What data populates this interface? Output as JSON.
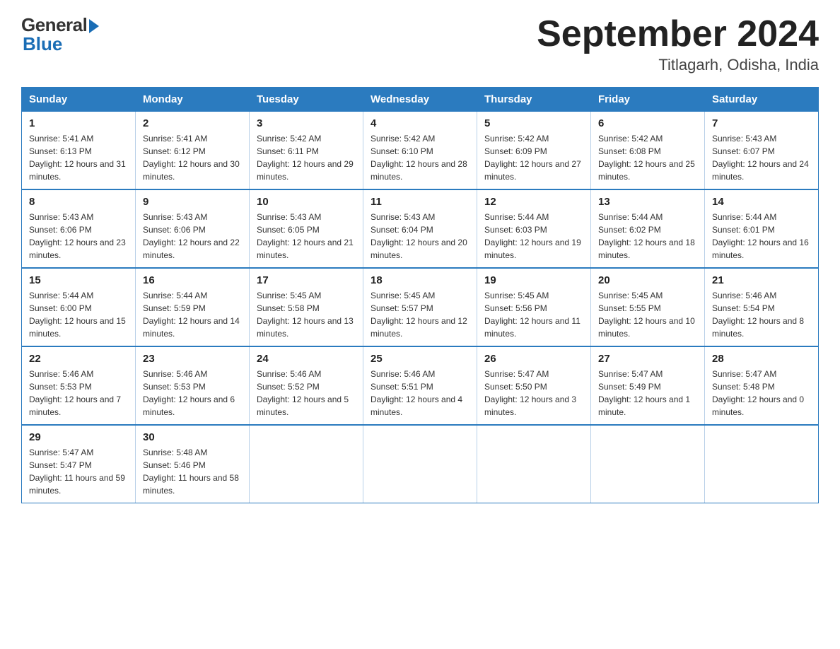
{
  "header": {
    "logo_general": "General",
    "logo_blue": "Blue",
    "month_title": "September 2024",
    "location": "Titlagarh, Odisha, India"
  },
  "days_of_week": [
    "Sunday",
    "Monday",
    "Tuesday",
    "Wednesday",
    "Thursday",
    "Friday",
    "Saturday"
  ],
  "weeks": [
    [
      {
        "day": "1",
        "sunrise": "5:41 AM",
        "sunset": "6:13 PM",
        "daylight": "12 hours and 31 minutes."
      },
      {
        "day": "2",
        "sunrise": "5:41 AM",
        "sunset": "6:12 PM",
        "daylight": "12 hours and 30 minutes."
      },
      {
        "day": "3",
        "sunrise": "5:42 AM",
        "sunset": "6:11 PM",
        "daylight": "12 hours and 29 minutes."
      },
      {
        "day": "4",
        "sunrise": "5:42 AM",
        "sunset": "6:10 PM",
        "daylight": "12 hours and 28 minutes."
      },
      {
        "day": "5",
        "sunrise": "5:42 AM",
        "sunset": "6:09 PM",
        "daylight": "12 hours and 27 minutes."
      },
      {
        "day": "6",
        "sunrise": "5:42 AM",
        "sunset": "6:08 PM",
        "daylight": "12 hours and 25 minutes."
      },
      {
        "day": "7",
        "sunrise": "5:43 AM",
        "sunset": "6:07 PM",
        "daylight": "12 hours and 24 minutes."
      }
    ],
    [
      {
        "day": "8",
        "sunrise": "5:43 AM",
        "sunset": "6:06 PM",
        "daylight": "12 hours and 23 minutes."
      },
      {
        "day": "9",
        "sunrise": "5:43 AM",
        "sunset": "6:06 PM",
        "daylight": "12 hours and 22 minutes."
      },
      {
        "day": "10",
        "sunrise": "5:43 AM",
        "sunset": "6:05 PM",
        "daylight": "12 hours and 21 minutes."
      },
      {
        "day": "11",
        "sunrise": "5:43 AM",
        "sunset": "6:04 PM",
        "daylight": "12 hours and 20 minutes."
      },
      {
        "day": "12",
        "sunrise": "5:44 AM",
        "sunset": "6:03 PM",
        "daylight": "12 hours and 19 minutes."
      },
      {
        "day": "13",
        "sunrise": "5:44 AM",
        "sunset": "6:02 PM",
        "daylight": "12 hours and 18 minutes."
      },
      {
        "day": "14",
        "sunrise": "5:44 AM",
        "sunset": "6:01 PM",
        "daylight": "12 hours and 16 minutes."
      }
    ],
    [
      {
        "day": "15",
        "sunrise": "5:44 AM",
        "sunset": "6:00 PM",
        "daylight": "12 hours and 15 minutes."
      },
      {
        "day": "16",
        "sunrise": "5:44 AM",
        "sunset": "5:59 PM",
        "daylight": "12 hours and 14 minutes."
      },
      {
        "day": "17",
        "sunrise": "5:45 AM",
        "sunset": "5:58 PM",
        "daylight": "12 hours and 13 minutes."
      },
      {
        "day": "18",
        "sunrise": "5:45 AM",
        "sunset": "5:57 PM",
        "daylight": "12 hours and 12 minutes."
      },
      {
        "day": "19",
        "sunrise": "5:45 AM",
        "sunset": "5:56 PM",
        "daylight": "12 hours and 11 minutes."
      },
      {
        "day": "20",
        "sunrise": "5:45 AM",
        "sunset": "5:55 PM",
        "daylight": "12 hours and 10 minutes."
      },
      {
        "day": "21",
        "sunrise": "5:46 AM",
        "sunset": "5:54 PM",
        "daylight": "12 hours and 8 minutes."
      }
    ],
    [
      {
        "day": "22",
        "sunrise": "5:46 AM",
        "sunset": "5:53 PM",
        "daylight": "12 hours and 7 minutes."
      },
      {
        "day": "23",
        "sunrise": "5:46 AM",
        "sunset": "5:53 PM",
        "daylight": "12 hours and 6 minutes."
      },
      {
        "day": "24",
        "sunrise": "5:46 AM",
        "sunset": "5:52 PM",
        "daylight": "12 hours and 5 minutes."
      },
      {
        "day": "25",
        "sunrise": "5:46 AM",
        "sunset": "5:51 PM",
        "daylight": "12 hours and 4 minutes."
      },
      {
        "day": "26",
        "sunrise": "5:47 AM",
        "sunset": "5:50 PM",
        "daylight": "12 hours and 3 minutes."
      },
      {
        "day": "27",
        "sunrise": "5:47 AM",
        "sunset": "5:49 PM",
        "daylight": "12 hours and 1 minute."
      },
      {
        "day": "28",
        "sunrise": "5:47 AM",
        "sunset": "5:48 PM",
        "daylight": "12 hours and 0 minutes."
      }
    ],
    [
      {
        "day": "29",
        "sunrise": "5:47 AM",
        "sunset": "5:47 PM",
        "daylight": "11 hours and 59 minutes."
      },
      {
        "day": "30",
        "sunrise": "5:48 AM",
        "sunset": "5:46 PM",
        "daylight": "11 hours and 58 minutes."
      },
      null,
      null,
      null,
      null,
      null
    ]
  ]
}
